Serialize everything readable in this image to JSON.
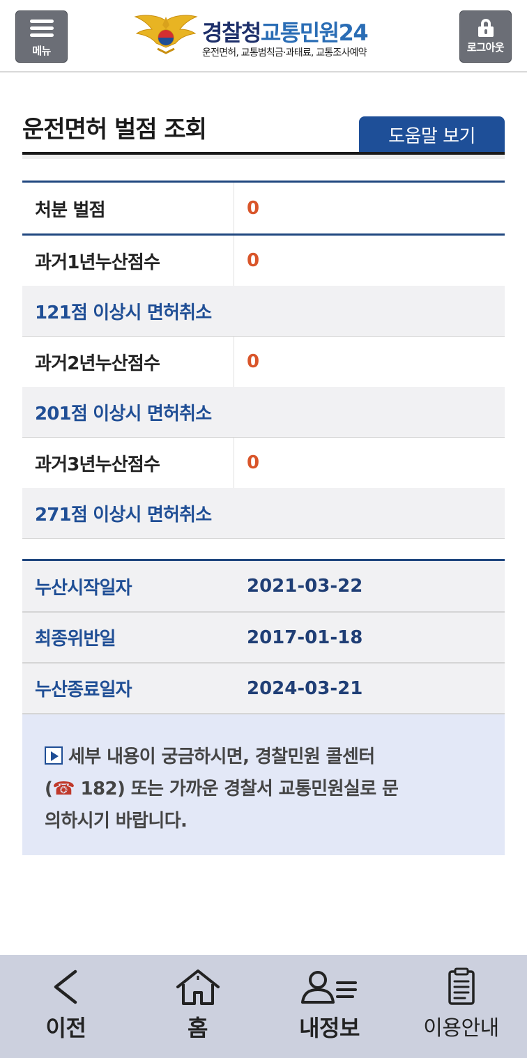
{
  "header": {
    "menu_label": "메뉴",
    "logout_label": "로그아웃",
    "logo_title_part1": "경찰청",
    "logo_title_part2": "교통민원24",
    "logo_subtitle": "운전면허, 교통범칙금·과태료, 교통조사예약"
  },
  "page": {
    "title": "운전면허 벌점 조회",
    "help_button": "도움말 보기"
  },
  "points": {
    "disposition_label": "처분 벌점",
    "disposition_value": "0",
    "rows": [
      {
        "label": "과거1년누산점수",
        "value": "0",
        "note": "121점 이상시 면허취소"
      },
      {
        "label": "과거2년누산점수",
        "value": "0",
        "note": "201점 이상시 면허취소"
      },
      {
        "label": "과거3년누산점수",
        "value": "0",
        "note": "271점 이상시 면허취소"
      }
    ]
  },
  "dates": [
    {
      "label": "누산시작일자",
      "value": "2021-03-22"
    },
    {
      "label": "최종위반일",
      "value": "2017-01-18"
    },
    {
      "label": "누산종료일자",
      "value": "2024-03-21"
    }
  ],
  "info": {
    "line1": "세부 내용이 궁금하시면, 경찰민원 콜센터",
    "phone_icon": "☎",
    "line2": " 182) 또는 가까운 경찰서 교통민원실로 문",
    "line3": "의하시기 바랍니다."
  },
  "nav": {
    "back": "이전",
    "home": "홈",
    "my_info": "내정보",
    "guide": "이용안내"
  },
  "colors": {
    "primary_blue": "#1e4f98",
    "value_orange": "#d9552a",
    "nav_bg": "#ccd0de",
    "info_bg": "#e3e8f7"
  }
}
